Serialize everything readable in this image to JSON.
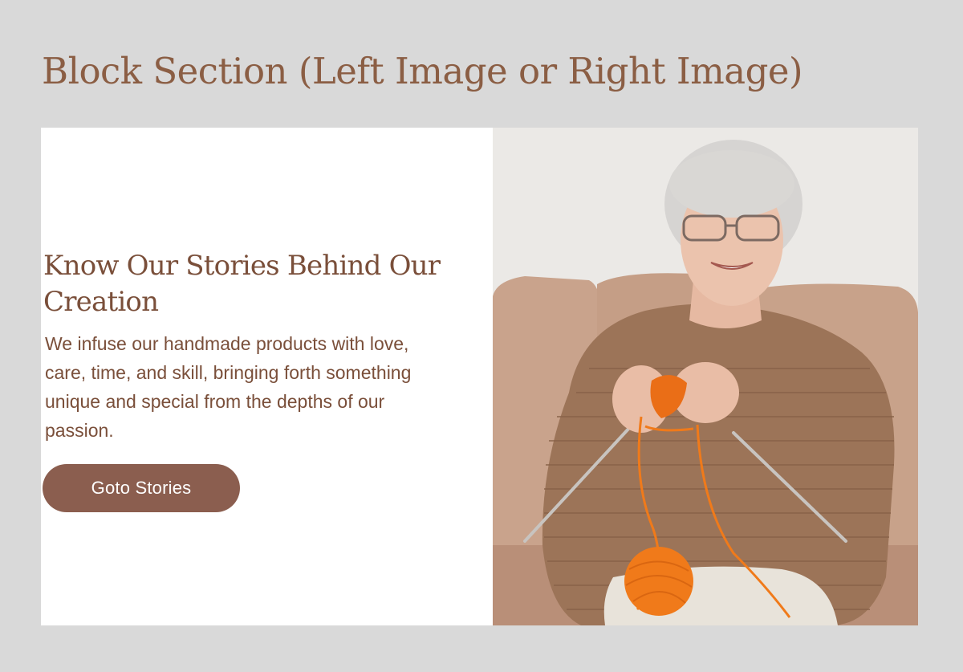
{
  "section": {
    "heading": "Block Section (Left Image or Right Image)"
  },
  "story": {
    "title": "Know Our Stories Behind Our Creation",
    "body": "We infuse our handmade products with love, care, time, and skill, bringing forth something unique and special from the depths of our passion.",
    "button_label": "Goto Stories"
  },
  "image": {
    "alt": "Smiling elderly woman knitting with orange yarn on a sofa"
  },
  "colors": {
    "page_background": "#d9d9d9",
    "accent_brown": "#8b5e4f",
    "text_brown": "#7a4f3a",
    "panel_white": "#ffffff",
    "yarn_orange": "#f07a1a"
  }
}
